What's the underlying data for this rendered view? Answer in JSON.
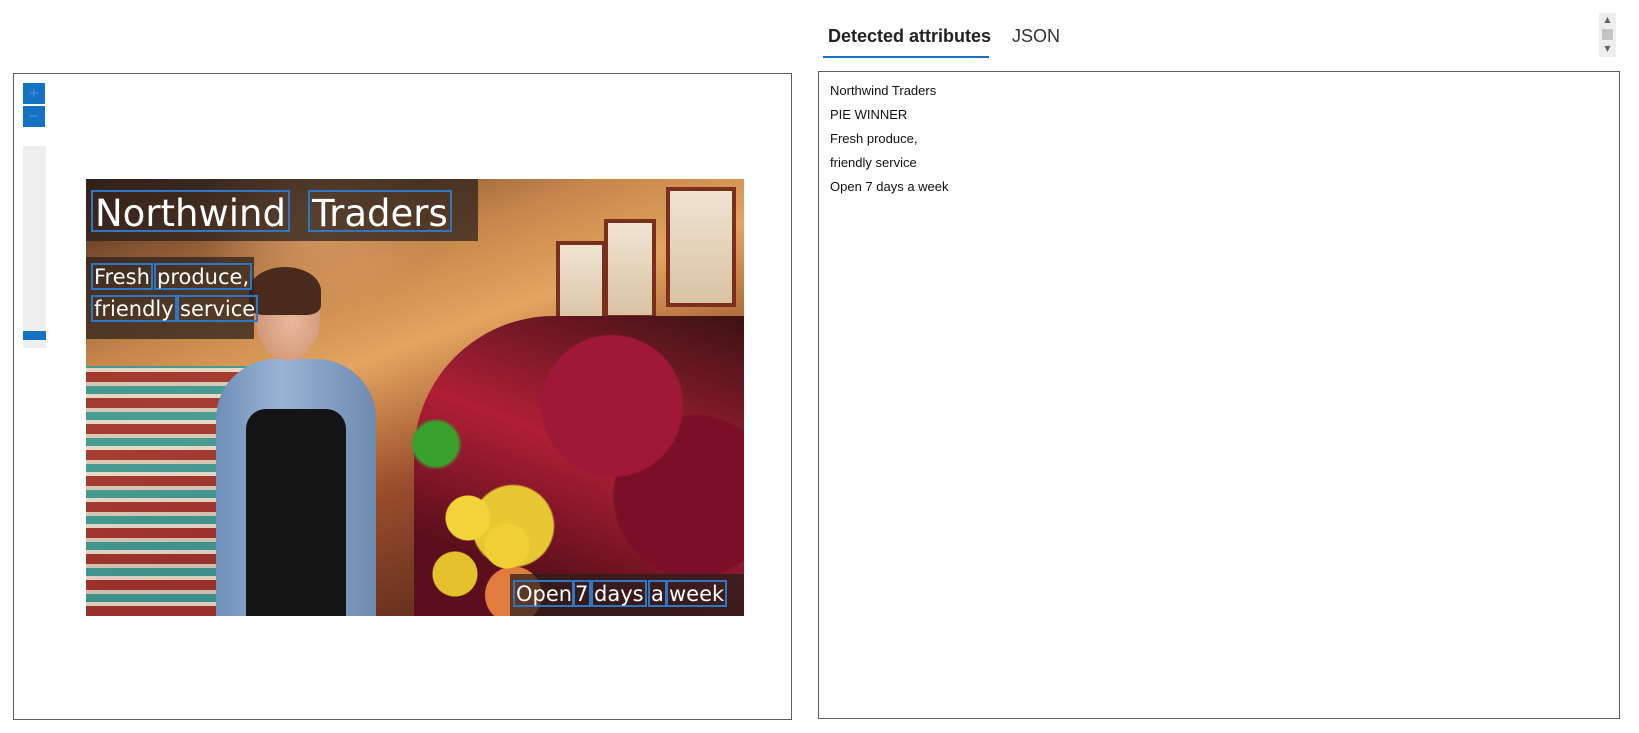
{
  "viewer": {
    "zoom_in_icon": "plus-icon",
    "zoom_out_icon": "minus-icon",
    "zoom_level": 0.96,
    "overlays": {
      "title_words": [
        "Northwind",
        "Traders"
      ],
      "subtitle_line1_words": [
        "Fresh",
        "produce,"
      ],
      "subtitle_line2_words": [
        "friendly",
        "service"
      ],
      "hours_words": [
        "Open",
        "7",
        "days",
        "a",
        "week"
      ]
    },
    "word_box_color": "#2d77c4"
  },
  "tabs": [
    {
      "label": "Detected attributes",
      "active": true
    },
    {
      "label": "JSON",
      "active": false
    }
  ],
  "results": {
    "lines": [
      "Northwind Traders",
      "PIE WINNER",
      "Fresh produce,",
      "friendly service",
      "Open 7 days a week"
    ]
  },
  "colors": {
    "accent": "#1372c4",
    "border": "#5f5f5f"
  }
}
